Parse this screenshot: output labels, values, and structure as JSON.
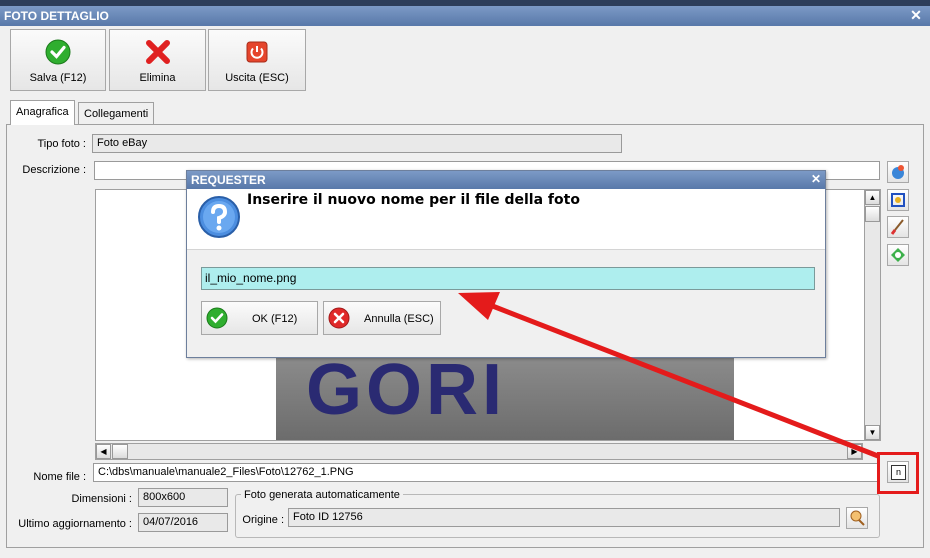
{
  "window": {
    "title": "FOTO DETTAGLIO",
    "close_glyph": "✕"
  },
  "toolbar": {
    "save_label": "Salva (F12)",
    "delete_label": "Elimina",
    "exit_label": "Uscita (ESC)"
  },
  "tabs": [
    {
      "label": "Anagrafica"
    },
    {
      "label": "Collegamenti"
    }
  ],
  "form": {
    "tipo_foto_label": "Tipo foto :",
    "tipo_foto_value": "Foto eBay",
    "descrizione_label": "Descrizione :",
    "descrizione_value": "",
    "nome_file_label": "Nome file :",
    "nome_file_value": "C:\\dbs\\manuale\\manuale2_Files\\Foto\\12762_1.PNG",
    "dimensioni_label": "Dimensioni :",
    "dimensioni_value": "800x600",
    "ultimo_agg_label": "Ultimo aggiornamento :",
    "ultimo_agg_value": "04/07/2016",
    "group_title": "Foto generata automaticamente",
    "origine_label": "Origine :",
    "origine_value": "Foto ID 12756"
  },
  "image_text": "GORI",
  "requester": {
    "title": "REQUESTER",
    "close_glyph": "✕",
    "message": "Inserire il nuovo nome per il file della foto",
    "input_value": "il_mio_nome.png",
    "ok_label": "OK (F12)",
    "cancel_label": "Annulla (ESC)"
  },
  "colors": {
    "accent_red": "#e41b1b",
    "input_bg": "#aeeeee",
    "title_blue": "#6384b5"
  },
  "rename_button_label": "n"
}
